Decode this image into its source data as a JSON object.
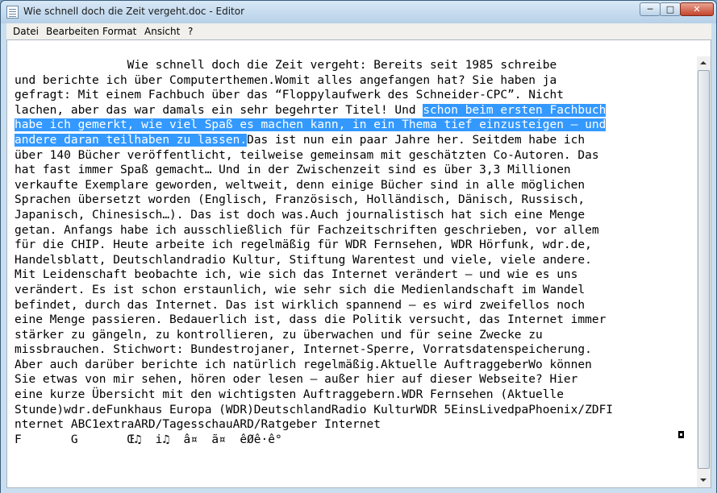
{
  "window": {
    "title": "Wie schnell doch die Zeit vergeht.doc - Editor",
    "controls": {
      "minimize": "─",
      "maximize": "□",
      "close": "✕"
    }
  },
  "menu": [
    "Datei",
    "Bearbeiten",
    "Format",
    "Ansicht",
    "?"
  ],
  "document": {
    "line1": "                Wie schnell doch die Zeit vergeht: Bereits seit 1985 schreibe",
    "line2": "und berichte ich über Computerthemen.Womit alles angefangen hat? Sie haben ja",
    "line3": "gefragt: Mit einem Fachbuch über das “Floppylaufwerk des Schneider-CPC”. Nicht",
    "line4_plain": "lachen, aber das war damals ein sehr begehrter Titel! Und ",
    "line4_selected": "schon beim ersten Fachbuch",
    "line5_selected": "habe ich gemerkt, wie viel Spaß es machen kann, in ein Thema tief einzusteigen – und",
    "line6_selected": "andere daran teilhaben zu lassen.",
    "line6_plain": "Das ist nun ein paar Jahre her. Seitdem habe ich",
    "line7": "über 140 Bücher veröffentlicht, teilweise gemeinsam mit geschätzten Co-Autoren. Das",
    "line8": "hat fast immer Spaß gemacht… Und in der Zwischenzeit sind es über 3,3 Millionen",
    "line9": "verkaufte Exemplare geworden, weltweit, denn einige Bücher sind in alle möglichen",
    "line10": "Sprachen übersetzt worden (Englisch, Französisch, Holländisch, Dänisch, Russisch,",
    "line11": "Japanisch, Chinesisch…). Das ist doch was.Auch journalistisch hat sich eine Menge",
    "line12": "getan. Anfangs habe ich ausschließlich für Fachzeitschriften geschrieben, vor allem",
    "line13": "für die CHIP. Heute arbeite ich regelmäßig für WDR Fernsehen, WDR Hörfunk, wdr.de,",
    "line14": "Handelsblatt, Deutschlandradio Kultur, Stiftung Warentest und viele, viele andere.",
    "line15": "Mit Leidenschaft beobachte ich, wie sich das Internet verändert – und wie es uns",
    "line16": "verändert. Es ist schon erstaunlich, wie sehr sich die Medienlandschaft im Wandel",
    "line17": "befindet, durch das Internet. Das ist wirklich spannend – es wird zweifellos noch",
    "line18": "eine Menge passieren. Bedauerlich ist, dass die Politik versucht, das Internet immer",
    "line19": "stärker zu gängeln, zu kontrollieren, zu überwachen und für seine Zwecke zu",
    "line20": "missbrauchen. Stichwort: Bundestrojaner, Internet-Sperre, Vorratsdatenspeicherung.",
    "line21": "Aber auch darüber berichte ich natürlich regelmäßig.Aktuelle AuftraggeberWo können",
    "line22": "Sie etwas von mir sehen, hören oder lesen – außer hier auf dieser Webseite? Hier",
    "line23": "eine kurze Übersicht mit den wichtigsten Auftraggebern.WDR Fernsehen (Aktuelle",
    "line24": "Stunde)wdr.deFunkhaus Europa (WDR)DeutschlandRadio KulturWDR 5EinsLivedpaPhoenix/ZDFI",
    "line25": "nternet ABC1extraARD/TagesschauARD/Ratgeber Internet",
    "line26": "F       G       Œ♫  i♫  â¤  ã¤  êØê·ê°"
  }
}
